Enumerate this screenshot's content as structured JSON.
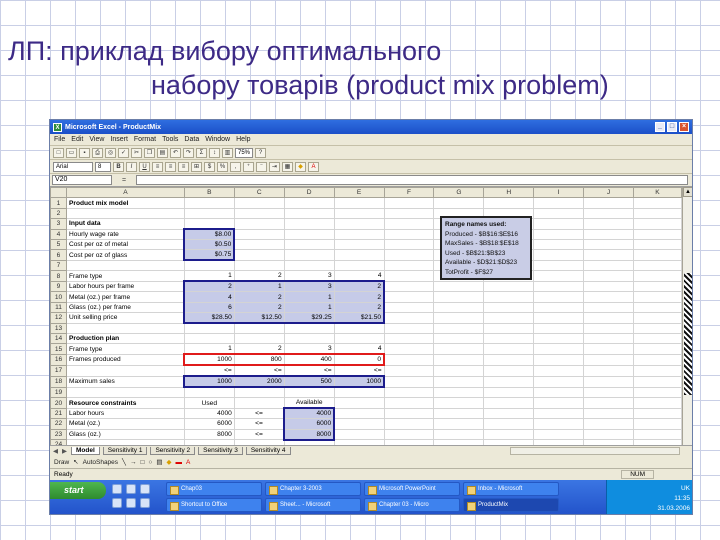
{
  "slide": {
    "title_line1": "ЛП: приклад вибору оптимального",
    "title_line2": "набору товарів (product mix problem)"
  },
  "window": {
    "title": "Microsoft Excel - ProductMix",
    "menus": [
      "File",
      "Edit",
      "View",
      "Insert",
      "Format",
      "Tools",
      "Data",
      "Window",
      "Help"
    ],
    "font_name": "Arial",
    "font_size": "8",
    "zoom": "75%",
    "name_box": "V20",
    "fx": "="
  },
  "columns": [
    "A",
    "B",
    "C",
    "D",
    "E",
    "F",
    "G",
    "H",
    "I",
    "J",
    "K"
  ],
  "rows": [
    {
      "n": "1",
      "a": "Product mix model",
      "b": "",
      "c": "",
      "d": "",
      "e": "",
      "bold": true
    },
    {
      "n": "2",
      "a": "",
      "b": "",
      "c": "",
      "d": "",
      "e": ""
    },
    {
      "n": "3",
      "a": "Input data",
      "b": "",
      "c": "",
      "d": "",
      "e": "",
      "bold": true
    },
    {
      "n": "4",
      "a": "Hourly wage rate",
      "b": "$8.00",
      "c": "",
      "d": "",
      "e": ""
    },
    {
      "n": "5",
      "a": "Cost per oz of metal",
      "b": "$0.50",
      "c": "",
      "d": "",
      "e": ""
    },
    {
      "n": "6",
      "a": "Cost per oz of glass",
      "b": "$0.75",
      "c": "",
      "d": "",
      "e": ""
    },
    {
      "n": "7",
      "a": "",
      "b": "",
      "c": "",
      "d": "",
      "e": ""
    },
    {
      "n": "8",
      "a": "Frame type",
      "b": "1",
      "c": "2",
      "d": "3",
      "e": "4"
    },
    {
      "n": "9",
      "a": "Labor hours per frame",
      "b": "2",
      "c": "1",
      "d": "3",
      "e": "2"
    },
    {
      "n": "10",
      "a": "Metal (oz.) per frame",
      "b": "4",
      "c": "2",
      "d": "1",
      "e": "2"
    },
    {
      "n": "11",
      "a": "Glass (oz.) per frame",
      "b": "6",
      "c": "2",
      "d": "1",
      "e": "2"
    },
    {
      "n": "12",
      "a": "Unit selling price",
      "b": "$28.50",
      "c": "$12.50",
      "d": "$29.25",
      "e": "$21.50"
    },
    {
      "n": "13",
      "a": "",
      "b": "",
      "c": "",
      "d": "",
      "e": ""
    },
    {
      "n": "14",
      "a": "Production plan",
      "b": "",
      "c": "",
      "d": "",
      "e": "",
      "bold": true
    },
    {
      "n": "15",
      "a": "Frame type",
      "b": "1",
      "c": "2",
      "d": "3",
      "e": "4"
    },
    {
      "n": "16",
      "a": "Frames produced",
      "b": "1000",
      "c": "800",
      "d": "400",
      "e": "0"
    },
    {
      "n": "17",
      "a": "",
      "b": "<=",
      "c": "<=",
      "d": "<=",
      "e": "<="
    },
    {
      "n": "18",
      "a": "Maximum sales",
      "b": "1000",
      "c": "2000",
      "d": "500",
      "e": "1000"
    },
    {
      "n": "19",
      "a": "",
      "b": "",
      "c": "",
      "d": "",
      "e": ""
    },
    {
      "n": "20",
      "a": "Resource constraints",
      "b": "Used",
      "c": "",
      "d": "Available",
      "e": "",
      "bold": true
    },
    {
      "n": "21",
      "a": "Labor hours",
      "b": "4000",
      "c": "<=",
      "d": "4000",
      "e": ""
    },
    {
      "n": "22",
      "a": "Metal (oz.)",
      "b": "6000",
      "c": "<=",
      "d": "6000",
      "e": ""
    },
    {
      "n": "23",
      "a": "Glass (oz.)",
      "b": "8000",
      "c": "<=",
      "d": "8000",
      "e": ""
    },
    {
      "n": "24",
      "a": "",
      "b": "",
      "c": "",
      "d": "",
      "e": ""
    }
  ],
  "range_names": {
    "header": "Range names used:",
    "items": [
      "Produced - $B$16:$E$16",
      "MaxSales - $B$18:$E$18",
      "Used - $B$21:$B$23",
      "Available - $D$21:$D$23",
      "TotProfit - $F$27"
    ]
  },
  "sheet_tabs": [
    "Model",
    "Sensitivity 1",
    "Sensitivity 2",
    "Sensitivity 3",
    "Sensitivity 4"
  ],
  "drawbar": {
    "draw": "Draw",
    "autoshapes": "AutoShapes"
  },
  "status": {
    "left": "Ready",
    "right": "NUM"
  },
  "taskbar": {
    "start": "start",
    "tasks": [
      "Chap03",
      "Chapter 3-2003",
      "Microsoft PowerPoint",
      "Inbox - Microsoft",
      "Shortcut to Office",
      "Sheet... - Microsoft",
      "Chapter 03 - Micro",
      "ProductMix"
    ],
    "lang": "UK",
    "time": "11:35",
    "date": "31.03.2006"
  }
}
